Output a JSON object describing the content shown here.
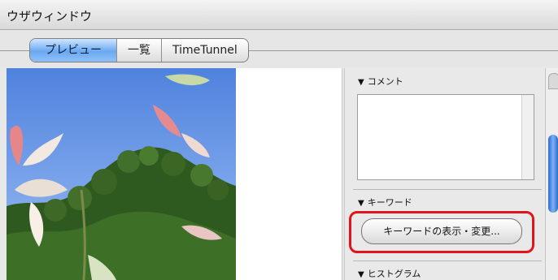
{
  "window": {
    "title": "ウザウィンドウ"
  },
  "tabs": [
    {
      "label": "プレビュー",
      "active": true
    },
    {
      "label": "一覧",
      "active": false
    },
    {
      "label": "TimeTunnel",
      "active": false
    }
  ],
  "panel": {
    "comment_header": "コメント",
    "keyword_header": "キーワード",
    "keyword_button": "キーワードの表示・変更...",
    "histogram_header": "ヒストグラム"
  },
  "colors": {
    "accent_tab": "#6aa9f0",
    "highlight": "#e0141a",
    "scroll_thumb": "#2b6ad1"
  }
}
